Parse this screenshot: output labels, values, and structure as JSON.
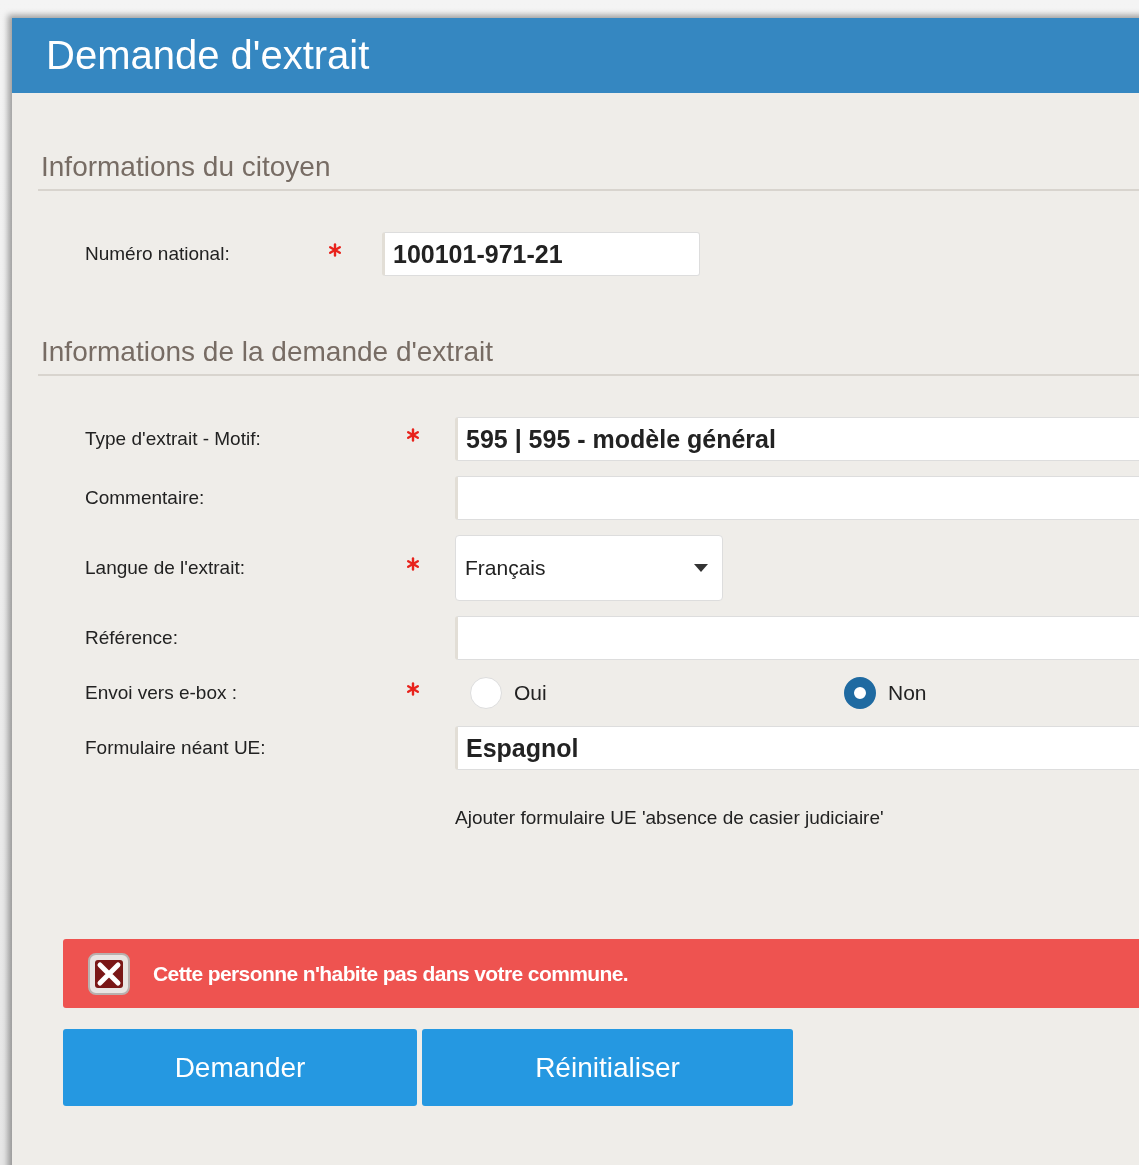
{
  "window": {
    "title": "Demande d'extrait"
  },
  "sections": [
    {
      "title": "Informations du citoyen",
      "fields": [
        {
          "kind": "text",
          "label": "Numéro national:",
          "required": true,
          "value": "100101-971-21"
        }
      ]
    },
    {
      "title": "Informations de la demande d'extrait",
      "fields": [
        {
          "kind": "text",
          "label": "Type d'extrait - Motif:",
          "required": true,
          "value": "595 | 595 - modèle général"
        },
        {
          "kind": "text",
          "label": "Commentaire:",
          "required": false
        },
        {
          "kind": "select",
          "label": "Langue de l'extrait:",
          "required": true,
          "value": "Français"
        },
        {
          "kind": "text",
          "label": "Référence:",
          "required": false
        },
        {
          "kind": "radio",
          "label": "Envoi vers e-box :",
          "required": true,
          "options": [
            {
              "label": "Oui",
              "selected": false
            },
            {
              "label": "Non",
              "selected": true
            }
          ]
        },
        {
          "kind": "text",
          "label": "Formulaire néant UE:",
          "required": false,
          "value": "Espagnol",
          "hint": "Ajouter formulaire UE 'absence de casier judiciaire'"
        }
      ]
    }
  ],
  "alert": {
    "kind": "error",
    "message": "Cette personne n'habite pas dans votre commune."
  },
  "buttons": [
    "Demander",
    "Réinitialiser"
  ]
}
